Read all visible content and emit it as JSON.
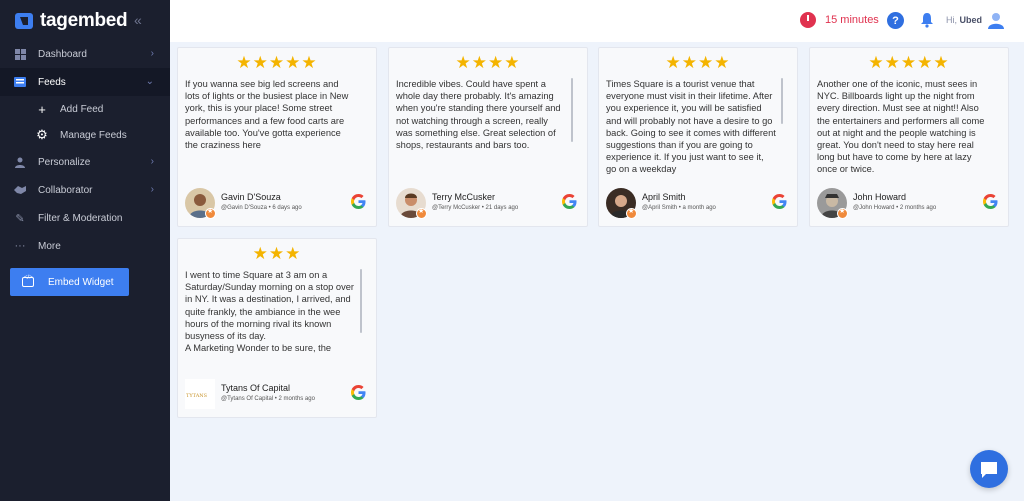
{
  "app": {
    "name": "tagembed"
  },
  "sidebar": {
    "items": [
      {
        "label": "Dashboard"
      },
      {
        "label": "Feeds"
      },
      {
        "label": "Add Feed"
      },
      {
        "label": "Manage Feeds"
      },
      {
        "label": "Personalize"
      },
      {
        "label": "Collaborator"
      },
      {
        "label": "Filter & Moderation"
      },
      {
        "label": "More"
      }
    ],
    "embed_label": "Embed Widget"
  },
  "topbar": {
    "timer": "15 minutes",
    "help": "?",
    "greeting": "Hi,",
    "user": "Ubed"
  },
  "colors": {
    "accent": "#3d7ef0",
    "sidebar_bg": "#1b1f2e",
    "star": "#f4b400",
    "timer": "#e0324f"
  },
  "reviews": [
    {
      "stars": "★★★★★",
      "text": "If you wanna see big led screens and lots of lights or the busiest place in New york, this is your place! Some street performances and a few food carts are available too. You've gotta experience the craziness here",
      "name": "Gavin D'Souza",
      "meta": "@Gavin D'Souza • 6 days ago"
    },
    {
      "stars": "★★★★",
      "text": "Incredible vibes. Could have spent a whole day there probably. It's amazing when you're standing there yourself and not watching through a screen, really was something else. Great selection of shops, restaurants and bars too.",
      "name": "Terry McCusker",
      "meta": "@Terry McCusker • 21 days ago"
    },
    {
      "stars": "★★★★",
      "text": "Times Square is a tourist venue that everyone must visit in their lifetime. After you experience it, you will be satisfied and will probably not have a desire to go back. Going to see it comes with different suggestions than if you are going to experience it. If you just want to see it, go on a weekday",
      "name": "April Smith",
      "meta": "@April Smith • a month ago"
    },
    {
      "stars": "★★★★★",
      "text": "Another one of the iconic, must sees in NYC. Billboards light up the night from every direction.  Must see at night!! Also the entertainers and performers all come out at night and the people watching is great.  You don't need to stay here real long but have to come by here at lazy once or twice.",
      "name": "John Howard",
      "meta": "@John Howard • 2 months ago"
    },
    {
      "stars": "★★★",
      "text": "I went to time Square at 3 am on a Saturday/Sunday morning on a stop over in NY.  It was a destination, I arrived, and quite frankly, the ambiance in the wee hours of the morning rival its known busyness of its day.\nA Marketing Wonder to be sure, the",
      "name": "Tytans Of Capital",
      "meta": "@Tytans Of Capital • 2 months ago"
    }
  ]
}
